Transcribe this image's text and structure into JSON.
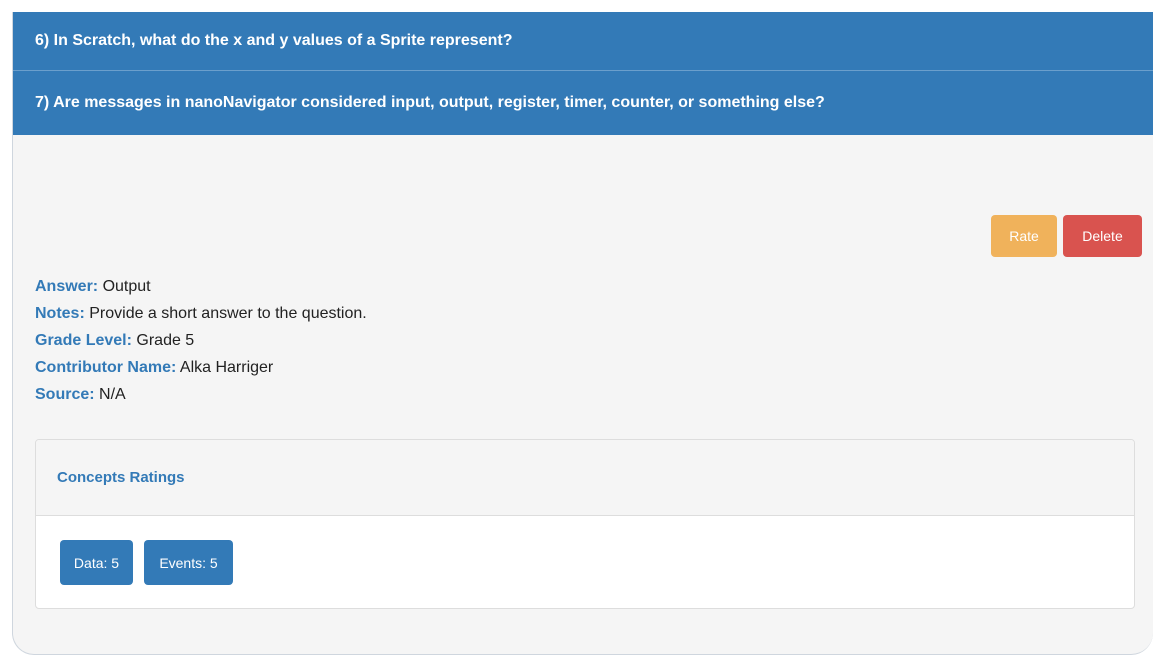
{
  "questions": [
    {
      "label": "6) In Scratch, what do the x and y values of a Sprite represent?"
    },
    {
      "label": "7) Are messages in nanoNavigator considered input, output, register, timer, counter, or something else?"
    }
  ],
  "actions": {
    "rate_label": "Rate",
    "delete_label": "Delete"
  },
  "details": {
    "answer_label": "Answer:",
    "answer_value": "Output",
    "notes_label": "Notes:",
    "notes_value": "Provide a short answer to the question.",
    "grade_label": "Grade Level:",
    "grade_value": "Grade 5",
    "contributor_label": "Contributor Name:",
    "contributor_value": "Alka Harriger",
    "source_label": "Source:",
    "source_value": "N/A"
  },
  "concepts": {
    "heading": "Concepts Ratings",
    "ratings": [
      {
        "label": "Data: 5"
      },
      {
        "label": "Events: 5"
      }
    ]
  },
  "colors": {
    "primary": "#337ab7",
    "warning": "#f0ad4e",
    "danger": "#d9534f",
    "panel_bg": "#f5f5f5"
  }
}
